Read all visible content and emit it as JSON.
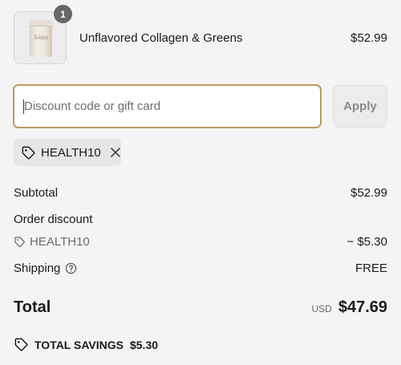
{
  "product": {
    "name": "Unflavored Collagen & Greens",
    "price": "$52.99",
    "quantity": "1",
    "image_brand": "Sāna"
  },
  "discount": {
    "placeholder": "Discount code or gift card",
    "value": "",
    "apply_label": "Apply",
    "applied_code": "HEALTH10"
  },
  "summary": {
    "subtotal_label": "Subtotal",
    "subtotal_value": "$52.99",
    "order_discount_label": "Order discount",
    "discount_code": "HEALTH10",
    "discount_value": "− $5.30",
    "shipping_label": "Shipping",
    "shipping_value": "FREE",
    "total_label": "Total",
    "currency": "USD",
    "total_value": "$47.69",
    "savings_label": "TOTAL SAVINGS",
    "savings_value": "$5.30"
  },
  "colors": {
    "background": "#f4f4f4",
    "input_focus_border": "#b89b62",
    "badge": "#666666"
  }
}
